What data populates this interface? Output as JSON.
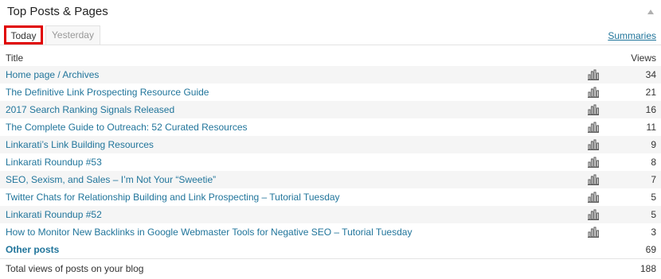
{
  "widget": {
    "title": "Top Posts & Pages",
    "summaries_link": "Summaries"
  },
  "tabs": [
    {
      "label": "Today",
      "active": true
    },
    {
      "label": "Yesterday",
      "active": false
    }
  ],
  "table": {
    "col_title": "Title",
    "col_views": "Views",
    "rows": [
      {
        "title": "Home page / Archives",
        "views": "34"
      },
      {
        "title": "The Definitive Link Prospecting Resource Guide",
        "views": "21"
      },
      {
        "title": "2017 Search Ranking Signals Released",
        "views": "16"
      },
      {
        "title": "The Complete Guide to Outreach: 52 Curated Resources",
        "views": "11"
      },
      {
        "title": "Linkarati’s Link Building Resources",
        "views": "9"
      },
      {
        "title": "Linkarati Roundup #53",
        "views": "8"
      },
      {
        "title": "SEO, Sexism, and Sales – I’m Not Your “Sweetie”",
        "views": "7"
      },
      {
        "title": "Twitter Chats for Relationship Building and Link Prospecting – Tutorial Tuesday",
        "views": "5"
      },
      {
        "title": "Linkarati Roundup #52",
        "views": "5"
      },
      {
        "title": "How to Monitor New Backlinks in Google Webmaster Tools for Negative SEO – Tutorial Tuesday",
        "views": "3"
      }
    ],
    "row_icon": "bar-chart-icon",
    "other": {
      "label": "Other posts",
      "views": "69"
    },
    "total": {
      "label": "Total views of posts on your blog",
      "views": "188"
    }
  },
  "colors": {
    "link": "#21759b",
    "highlight_border": "#e00000",
    "alt_row": "#f5f5f5"
  }
}
